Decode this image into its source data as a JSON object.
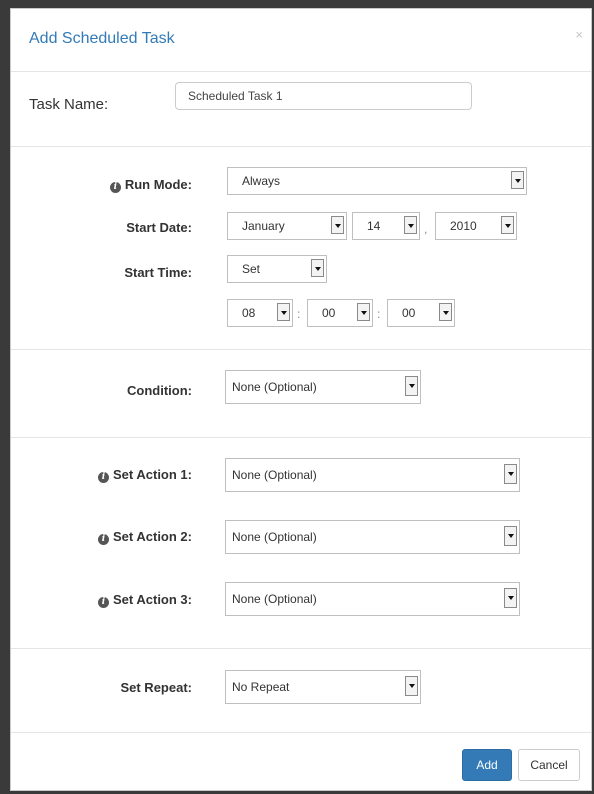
{
  "modal": {
    "title": "Add Scheduled Task",
    "close": "×"
  },
  "task_name": {
    "label": "Task Name:",
    "value": "Scheduled Task 1"
  },
  "run_mode": {
    "label": "Run Mode:",
    "value": "Always"
  },
  "start_date": {
    "label": "Start Date:",
    "month": "January",
    "day": "14",
    "year": "2010",
    "comma": ","
  },
  "start_time": {
    "label": "Start Time:",
    "mode": "Set",
    "hour": "08",
    "minute": "00",
    "second": "00",
    "colon": ":"
  },
  "condition": {
    "label": "Condition:",
    "value": "None (Optional)"
  },
  "actions": [
    {
      "label": "Set Action 1:",
      "value": "None (Optional)"
    },
    {
      "label": "Set Action 2:",
      "value": "None (Optional)"
    },
    {
      "label": "Set Action 3:",
      "value": "None (Optional)"
    }
  ],
  "repeat": {
    "label": "Set Repeat:",
    "value": "No Repeat"
  },
  "footer": {
    "add_label": "Add",
    "cancel_label": "Cancel"
  },
  "icons": {
    "info": "info-circle-icon",
    "dropdown": "chevron-down-icon",
    "close": "close-icon"
  },
  "colors": {
    "primary": "#337ab7",
    "title": "#337ab7"
  }
}
